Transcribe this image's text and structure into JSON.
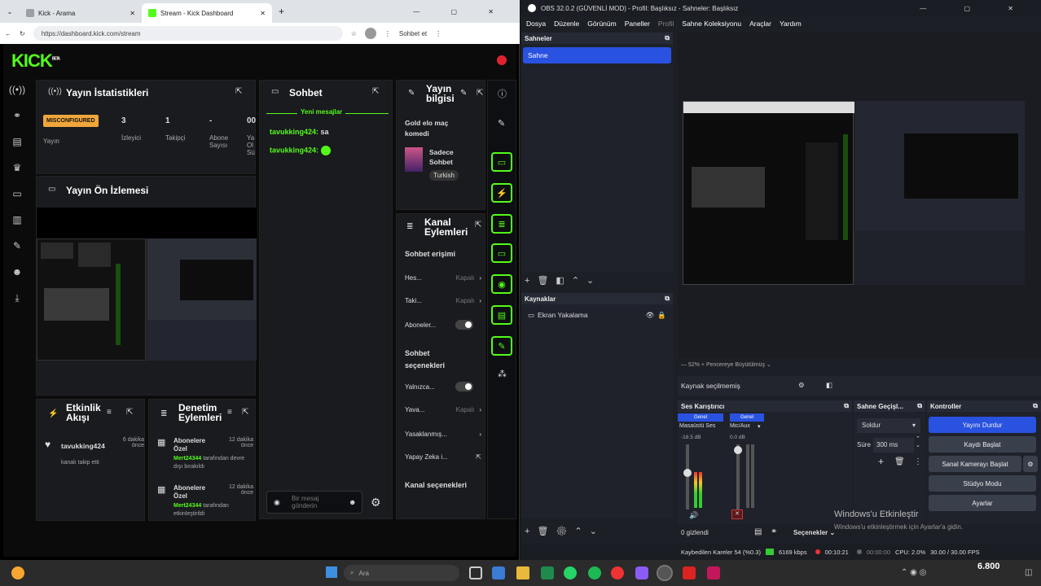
{
  "browser": {
    "tabs": [
      {
        "label": "Kick - Arama"
      },
      {
        "label": "Stream - Kick Dashboard"
      }
    ],
    "url": "https://dashboard.kick.com/stream",
    "profile_label": "Sohbet et"
  },
  "kick": {
    "logo": "KICK",
    "logo_badge": "BETA",
    "stats": {
      "title": "Yayın İstatistikleri",
      "status_badge": "MISCONFIGURED",
      "status_label": "Yayın",
      "viewers_value": "3",
      "viewers_label": "İzleyici",
      "followers_value": "1",
      "followers_label": "Takipçi",
      "subs_value": "-",
      "subs_label": "Abone Sayısı",
      "extra_value": "00",
      "extra_label": "Ya Ol Sü"
    },
    "preview": {
      "title": "Yayın Ön İzlemesi"
    },
    "chat": {
      "title": "Sohbet",
      "new_messages": "Yeni mesajlar",
      "messages": [
        {
          "user": "tavukking424:",
          "text": "sa"
        },
        {
          "user": "tavukking424:",
          "text": ""
        }
      ],
      "input_placeholder": "Bir mesaj gönderin"
    },
    "stream_info": {
      "title": "Yayın bilgisi",
      "stream_title": "Gold elo maç komedi",
      "category": "Sadece Sohbet",
      "language_tag": "Turkish"
    },
    "channel_actions": {
      "title": "Kanal Eylemleri",
      "chat_access": "Sohbet erişimi",
      "rows": [
        {
          "label": "Hes...",
          "value": "Kapalı"
        },
        {
          "label": "Taki...",
          "value": "Kapalı"
        },
        {
          "label": "Aboneler...",
          "value": ""
        }
      ],
      "chat_options": "Sohbet seçenekleri",
      "rows2": [
        {
          "label": "Yalnızca...",
          "value": ""
        },
        {
          "label": "Yava...",
          "value": "Kapalı"
        },
        {
          "label": "Yasaklanmış...",
          "value": ""
        },
        {
          "label": "Yapay Zeka i...",
          "value": ""
        }
      ],
      "channel_options": "Kanal seçenekleri"
    },
    "activity": {
      "title": "Etkinlik Akışı",
      "user": "tavukking424",
      "time": "6 dakika önce",
      "desc": "kanalı takip etti"
    },
    "moderation": {
      "title": "Denetim Eylemleri",
      "items": [
        {
          "title": "Abonelere Özel",
          "time": "12 dakika önce",
          "user": "Mert24344",
          "desc": "tarafından devre dışı bırakıldı"
        },
        {
          "title": "Abonelere Özel",
          "time": "12 dakika önce",
          "user": "Mert24344",
          "desc": "tarafından etkinleştirildi"
        }
      ]
    }
  },
  "obs": {
    "window_title": "OBS 32.0.2 (GÜVENLİ MOD) - Profil: Başlıksız - Sahneler: Başlıksız",
    "menu": [
      "Dosya",
      "Düzenle",
      "Görünüm",
      "Paneller",
      "Profil",
      "Sahne Koleksiyonu",
      "Araçlar",
      "Yardım"
    ],
    "scenes_title": "Sahneler",
    "scene_item": "Sahne",
    "sources_title": "Kaynaklar",
    "source_item": "Ekran Yakalama",
    "preview_scale": "52%",
    "preview_mode": "Pencereye Büyütülmüş",
    "no_source": "Kaynak seçilmemiş",
    "mixer": {
      "title": "Ses Karıştırıcı",
      "ch1_tag": "Genel",
      "ch1_name": "Masaüstü Ses",
      "ch1_db": "-18.5 dB",
      "ch2_tag": "Genel",
      "ch2_name": "Mic/Aux",
      "ch2_db": "0.0 dB",
      "hidden": "0 gizlendi"
    },
    "transition": {
      "title": "Sahne Geçişl...",
      "value": "Soldur",
      "duration_label": "Süre",
      "duration": "300 ms"
    },
    "controls": {
      "title": "Kontroller",
      "stop_stream": "Yayını Durdur",
      "start_record": "Kaydı Başlat",
      "virtual_cam": "Sanal Kamerayı Başlat",
      "studio_mode": "Stüdyo Modu",
      "settings": "Ayarlar"
    },
    "options_label": "Seçenekler",
    "status": {
      "dropped": "Kaybedilen Kareler 54 (%0.3)",
      "bitrate": "6169 kbps",
      "live_time": "00:10:21",
      "rec_time": "00:00:00",
      "cpu": "CPU: 2.0%",
      "fps": "30.00 / 30.00 FPS"
    },
    "watermark_title": "Windows'u Etkinleştir",
    "watermark_sub": "Windows'u etkinleştirmek için Ayarlar'a gidin."
  },
  "taskbar": {
    "search_placeholder": "Ara",
    "clock_value": "6.800"
  },
  "colors": {
    "kick_green": "#53fc18",
    "obs_blue": "#2952e0",
    "obs_bg": "#1d1f26"
  }
}
